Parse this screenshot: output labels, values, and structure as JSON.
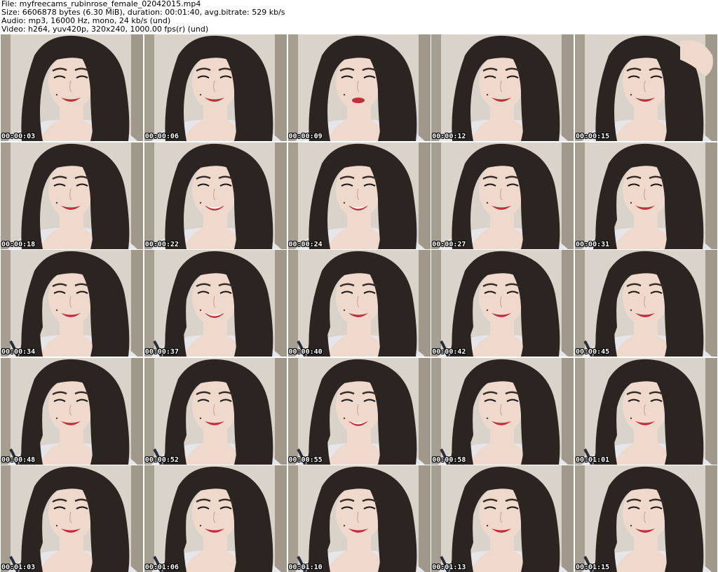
{
  "header": {
    "file_line": "File: myfreecams_rubinrose_female_02042015.mp4",
    "size_line": "Size: 6606878 bytes (6.30 MiB), duration: 00:01:40, avg.bitrate: 529 kb/s",
    "audio_line": "Audio: mp3, 16000 Hz, mono, 24 kb/s (und)",
    "video_line": "Video: h264, yuv420p, 320x240, 1000.00 fps(r) (und)"
  },
  "thumbnails": [
    {
      "timestamp": "00:00:03",
      "hair": "right",
      "mouth": "smile"
    },
    {
      "timestamp": "00:00:06",
      "hair": "right",
      "mouth": "smile"
    },
    {
      "timestamp": "00:00:09",
      "hair": "right",
      "mouth": "pout"
    },
    {
      "timestamp": "00:00:12",
      "hair": "right",
      "mouth": "smile"
    },
    {
      "timestamp": "00:00:15",
      "hair": "right",
      "mouth": "smile",
      "hand": true
    },
    {
      "timestamp": "00:00:18",
      "hair": "right",
      "mouth": "smile"
    },
    {
      "timestamp": "00:00:22",
      "hair": "right",
      "mouth": "grin"
    },
    {
      "timestamp": "00:00:24",
      "hair": "right",
      "mouth": "grin"
    },
    {
      "timestamp": "00:00:27",
      "hair": "right",
      "mouth": "smile"
    },
    {
      "timestamp": "00:00:31",
      "hair": "both",
      "mouth": "smile"
    },
    {
      "timestamp": "00:00:34",
      "hair": "both",
      "mouth": "smile"
    },
    {
      "timestamp": "00:00:37",
      "hair": "both",
      "mouth": "grin"
    },
    {
      "timestamp": "00:00:40",
      "hair": "both",
      "mouth": "smile"
    },
    {
      "timestamp": "00:00:42",
      "hair": "both",
      "mouth": "smile"
    },
    {
      "timestamp": "00:00:45",
      "hair": "both",
      "mouth": "smile"
    },
    {
      "timestamp": "00:00:48",
      "hair": "both",
      "mouth": "smile"
    },
    {
      "timestamp": "00:00:52",
      "hair": "both",
      "mouth": "smile"
    },
    {
      "timestamp": "00:00:55",
      "hair": "both",
      "mouth": "grin"
    },
    {
      "timestamp": "00:00:58",
      "hair": "both",
      "mouth": "smile"
    },
    {
      "timestamp": "00:01:01",
      "hair": "both",
      "mouth": "smile"
    },
    {
      "timestamp": "00:01:03",
      "hair": "both",
      "mouth": "smile"
    },
    {
      "timestamp": "00:01:06",
      "hair": "both",
      "mouth": "smile"
    },
    {
      "timestamp": "00:01:10",
      "hair": "both",
      "mouth": "smile"
    },
    {
      "timestamp": "00:01:13",
      "hair": "both",
      "mouth": "smile"
    },
    {
      "timestamp": "00:01:15",
      "hair": "both",
      "mouth": "smile"
    }
  ],
  "colors": {
    "background_wall": "#d9d3cc",
    "curtain": "#7c7260",
    "hair": "#2b2420",
    "skin": "#efd9cc",
    "lips": "#c0303a",
    "brow": "#3a2c26",
    "top": "#e6e6ea",
    "strap": "#2a2e3a"
  }
}
